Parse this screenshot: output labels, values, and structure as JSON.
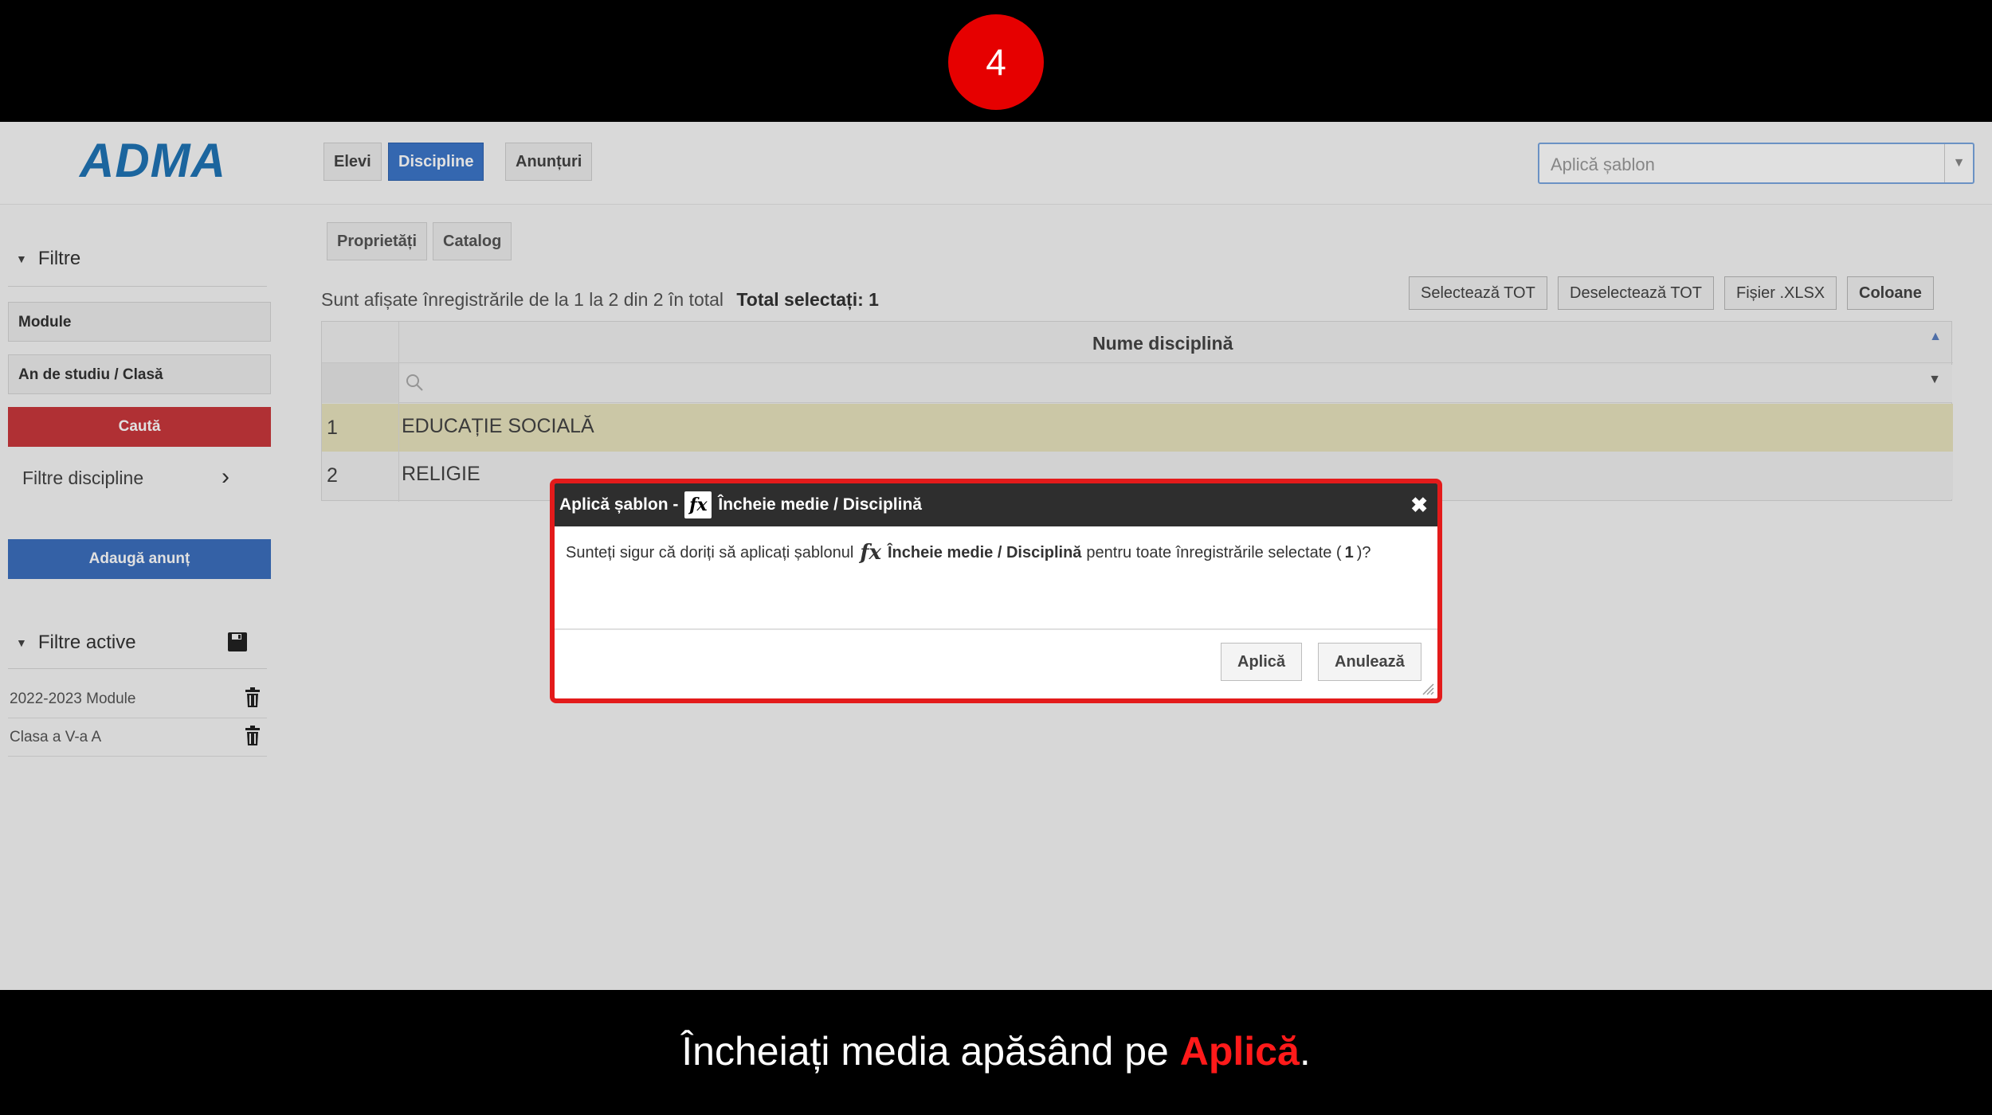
{
  "step": "4",
  "app": {
    "logo": "ADMA",
    "tabs": [
      "Elevi",
      "Discipline",
      "Anunțuri"
    ],
    "active_tab": "Discipline",
    "template_placeholder": "Aplică șablon"
  },
  "sidebar": {
    "filters_title": "Filtre",
    "module_field": "Module",
    "class_field": "An de studiu / Clasă",
    "search_button": "Caută",
    "discipline_filters": "Filtre discipline",
    "add_announcement_button": "Adaugă anunț",
    "active_filters_title": "Filtre active",
    "active_filters": [
      "2022-2023 Module",
      "Clasa a V-a A"
    ]
  },
  "main": {
    "subtabs": [
      "Proprietăți",
      "Catalog"
    ],
    "records_info": "Sunt afișate înregistrările de la 1 la 2 din 2 în total",
    "total_selected": "Total selectați: 1",
    "toolbar": {
      "select_all": "Selectează TOT",
      "deselect_all": "Deselectează TOT",
      "xlsx": "Fișier .XLSX",
      "columns": "Coloane"
    },
    "grid": {
      "column_header": "Nume disciplină",
      "rows": [
        {
          "num": "1",
          "name": "EDUCAȚIE SOCIALĂ"
        },
        {
          "num": "2",
          "name": "RELIGIE"
        }
      ]
    }
  },
  "dialog": {
    "title_prefix": "Aplică șablon -",
    "title_suffix": "Încheie medie / Disciplină",
    "body_pre": "Sunteți sigur că doriți să aplicați șablonul",
    "body_template": "Încheie medie / Disciplină",
    "body_post_a": "pentru toate înregistrările selectate (",
    "body_count": "1",
    "body_post_b": ")?",
    "apply_button": "Aplică",
    "cancel_button": "Anulează"
  },
  "caption": {
    "text_before": "Încheiați media apăsând pe",
    "highlight": "Aplică",
    "text_after": "."
  },
  "colors": {
    "accent_red": "#e31b1b",
    "brand_blue": "#1f74b4",
    "active_tab_blue": "#3c76c9"
  }
}
